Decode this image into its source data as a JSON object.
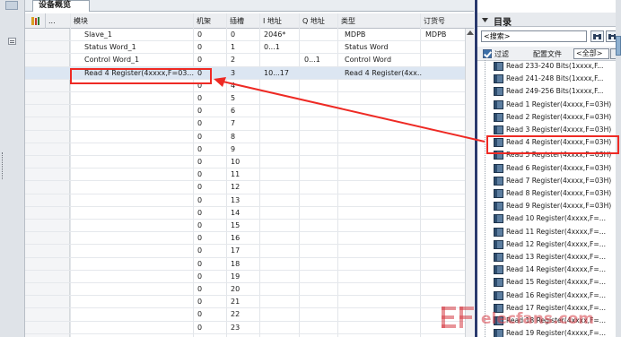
{
  "window": {
    "tab_label": "设备概览"
  },
  "table": {
    "columns": [
      "...",
      "模块",
      "机架",
      "插槽",
      "I 地址",
      "Q 地址",
      "类型",
      "订货号"
    ],
    "rows": [
      {
        "module": "Slave_1",
        "rack": "0",
        "slot": "0",
        "i_addr": "2046*",
        "q_addr": "",
        "type": "MDPB",
        "order": "MDPB",
        "selected": false
      },
      {
        "module": "Status Word_1",
        "rack": "0",
        "slot": "1",
        "i_addr": "0...1",
        "q_addr": "",
        "type": "Status Word",
        "order": "",
        "selected": false
      },
      {
        "module": "Control Word_1",
        "rack": "0",
        "slot": "2",
        "i_addr": "",
        "q_addr": "0...1",
        "type": "Control Word",
        "order": "",
        "selected": false
      },
      {
        "module": "Read 4 Register(4xxxx,F=03...",
        "rack": "0",
        "slot": "3",
        "i_addr": "10...17",
        "q_addr": "",
        "type": "Read 4 Register(4xx...",
        "order": "",
        "selected": true
      },
      {
        "module": "",
        "rack": "0",
        "slot": "4",
        "i_addr": "",
        "q_addr": "",
        "type": "",
        "order": "",
        "selected": false
      },
      {
        "module": "",
        "rack": "0",
        "slot": "5",
        "i_addr": "",
        "q_addr": "",
        "type": "",
        "order": "",
        "selected": false
      },
      {
        "module": "",
        "rack": "0",
        "slot": "6",
        "i_addr": "",
        "q_addr": "",
        "type": "",
        "order": "",
        "selected": false
      },
      {
        "module": "",
        "rack": "0",
        "slot": "7",
        "i_addr": "",
        "q_addr": "",
        "type": "",
        "order": "",
        "selected": false
      },
      {
        "module": "",
        "rack": "0",
        "slot": "8",
        "i_addr": "",
        "q_addr": "",
        "type": "",
        "order": "",
        "selected": false
      },
      {
        "module": "",
        "rack": "0",
        "slot": "9",
        "i_addr": "",
        "q_addr": "",
        "type": "",
        "order": "",
        "selected": false
      },
      {
        "module": "",
        "rack": "0",
        "slot": "10",
        "i_addr": "",
        "q_addr": "",
        "type": "",
        "order": "",
        "selected": false
      },
      {
        "module": "",
        "rack": "0",
        "slot": "11",
        "i_addr": "",
        "q_addr": "",
        "type": "",
        "order": "",
        "selected": false
      },
      {
        "module": "",
        "rack": "0",
        "slot": "12",
        "i_addr": "",
        "q_addr": "",
        "type": "",
        "order": "",
        "selected": false
      },
      {
        "module": "",
        "rack": "0",
        "slot": "13",
        "i_addr": "",
        "q_addr": "",
        "type": "",
        "order": "",
        "selected": false
      },
      {
        "module": "",
        "rack": "0",
        "slot": "14",
        "i_addr": "",
        "q_addr": "",
        "type": "",
        "order": "",
        "selected": false
      },
      {
        "module": "",
        "rack": "0",
        "slot": "15",
        "i_addr": "",
        "q_addr": "",
        "type": "",
        "order": "",
        "selected": false
      },
      {
        "module": "",
        "rack": "0",
        "slot": "16",
        "i_addr": "",
        "q_addr": "",
        "type": "",
        "order": "",
        "selected": false
      },
      {
        "module": "",
        "rack": "0",
        "slot": "17",
        "i_addr": "",
        "q_addr": "",
        "type": "",
        "order": "",
        "selected": false
      },
      {
        "module": "",
        "rack": "0",
        "slot": "18",
        "i_addr": "",
        "q_addr": "",
        "type": "",
        "order": "",
        "selected": false
      },
      {
        "module": "",
        "rack": "0",
        "slot": "19",
        "i_addr": "",
        "q_addr": "",
        "type": "",
        "order": "",
        "selected": false
      },
      {
        "module": "",
        "rack": "0",
        "slot": "20",
        "i_addr": "",
        "q_addr": "",
        "type": "",
        "order": "",
        "selected": false
      },
      {
        "module": "",
        "rack": "0",
        "slot": "21",
        "i_addr": "",
        "q_addr": "",
        "type": "",
        "order": "",
        "selected": false
      },
      {
        "module": "",
        "rack": "0",
        "slot": "22",
        "i_addr": "",
        "q_addr": "",
        "type": "",
        "order": "",
        "selected": false
      },
      {
        "module": "",
        "rack": "0",
        "slot": "23",
        "i_addr": "",
        "q_addr": "",
        "type": "",
        "order": "",
        "selected": false
      }
    ]
  },
  "catalog": {
    "title": "目录",
    "search_placeholder": "<搜索>",
    "filter_label": "过滤",
    "profile_label": "配置文件",
    "profile_value": "<全部>",
    "items": [
      "Read 233-240 Bits(1xxxx,F...",
      "Read 241-248 Bits(1xxxx,F...",
      "Read 249-256 Bits(1xxxx,F...",
      "Read 1 Register(4xxxx,F=03H)",
      "Read 2 Register(4xxxx,F=03H)",
      "Read 3 Register(4xxxx,F=03H)",
      "Read 4 Register(4xxxx,F=03H)",
      "Read 5 Register(4xxxx,F=03H)",
      "Read 6 Register(4xxxx,F=03H)",
      "Read 7 Register(4xxxx,F=03H)",
      "Read 8 Register(4xxxx,F=03H)",
      "Read 9 Register(4xxxx,F=03H)",
      "Read 10 Register(4xxxx,F=...",
      "Read 11 Register(4xxxx,F=...",
      "Read 12 Register(4xxxx,F=...",
      "Read 13 Register(4xxxx,F=...",
      "Read 14 Register(4xxxx,F=...",
      "Read 15 Register(4xxxx,F=...",
      "Read 16 Register(4xxxx,F=...",
      "Read 17 Register(4xxxx,F=...",
      "Read 18 Register(4xxxx,F=...",
      "Read 19 Register(4xxxx,F=..."
    ],
    "highlighted_index": 6
  },
  "watermark": {
    "text": "elecfans.com"
  },
  "colors": {
    "highlight": "#ee2a24",
    "selection": "#dce6f2",
    "divider": "#2a3a6e",
    "header": "#eceef1"
  }
}
